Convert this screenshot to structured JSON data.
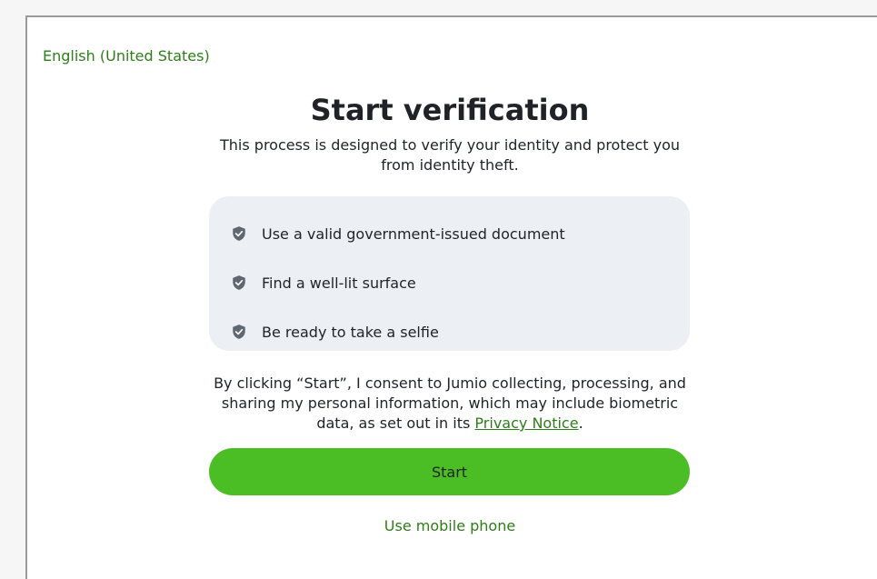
{
  "language_selector": {
    "label": "English (United States)"
  },
  "header": {
    "title": "Start verification",
    "subtitle": "This process is designed to verify your identity and protect you from identity theft."
  },
  "checklist": {
    "items": [
      {
        "icon": "shield-check-icon",
        "label": "Use a valid government-issued document"
      },
      {
        "icon": "shield-check-icon",
        "label": "Find a well-lit surface"
      },
      {
        "icon": "shield-check-icon",
        "label": "Be ready to take a selfie"
      }
    ]
  },
  "consent": {
    "text_before": "By clicking “Start”, I consent to Jumio collecting, processing, and sharing my personal information, which may include biometric data, as set out in its ",
    "link_label": "Privacy Notice",
    "text_after": "."
  },
  "actions": {
    "start_label": "Start",
    "mobile_label": "Use mobile phone"
  },
  "colors": {
    "accent": "#4bbe25",
    "link": "#2e7d1a",
    "panel": "#eceff3",
    "icon": "#5f6770"
  }
}
